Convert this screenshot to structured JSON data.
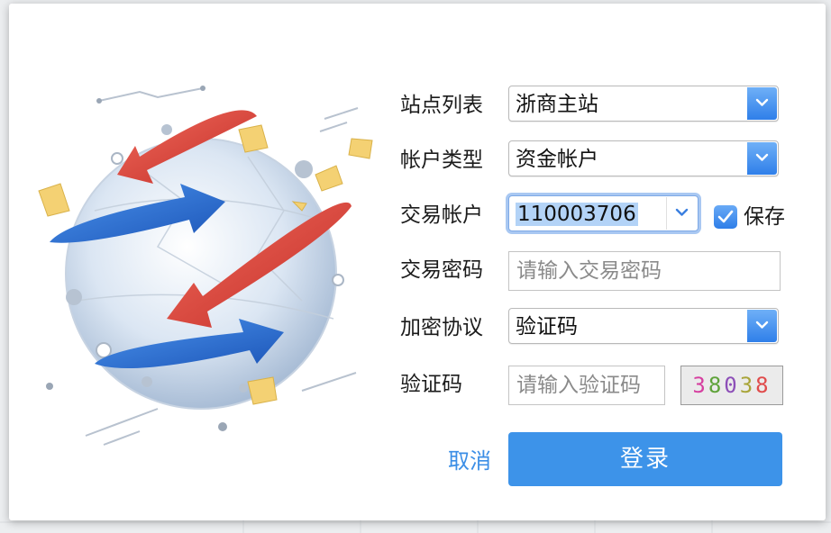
{
  "form": {
    "site_list": {
      "label": "站点列表",
      "value": "浙商主站"
    },
    "account_type": {
      "label": "帐户类型",
      "value": "资金帐户"
    },
    "trade_account": {
      "label": "交易帐户",
      "value": "110003706"
    },
    "save": {
      "label": "保存",
      "checked": true
    },
    "trade_password": {
      "label": "交易密码",
      "placeholder": "请输入交易密码"
    },
    "encryption_protocol": {
      "label": "加密协议",
      "value": "验证码"
    },
    "captcha": {
      "label": "验证码",
      "placeholder": "请输入验证码",
      "code": [
        "3",
        "8",
        "0",
        "3",
        "8"
      ]
    }
  },
  "actions": {
    "cancel": "取消",
    "login": "登录"
  },
  "colors": {
    "accent": "#3d93e9",
    "link": "#3b8ee6",
    "arrow_red": "#d9413c",
    "arrow_blue": "#2f72d6"
  },
  "icons": {
    "dropdown": "chevron-down-icon",
    "check": "checkmark-icon",
    "illustration": "globe-arrows-icon"
  }
}
